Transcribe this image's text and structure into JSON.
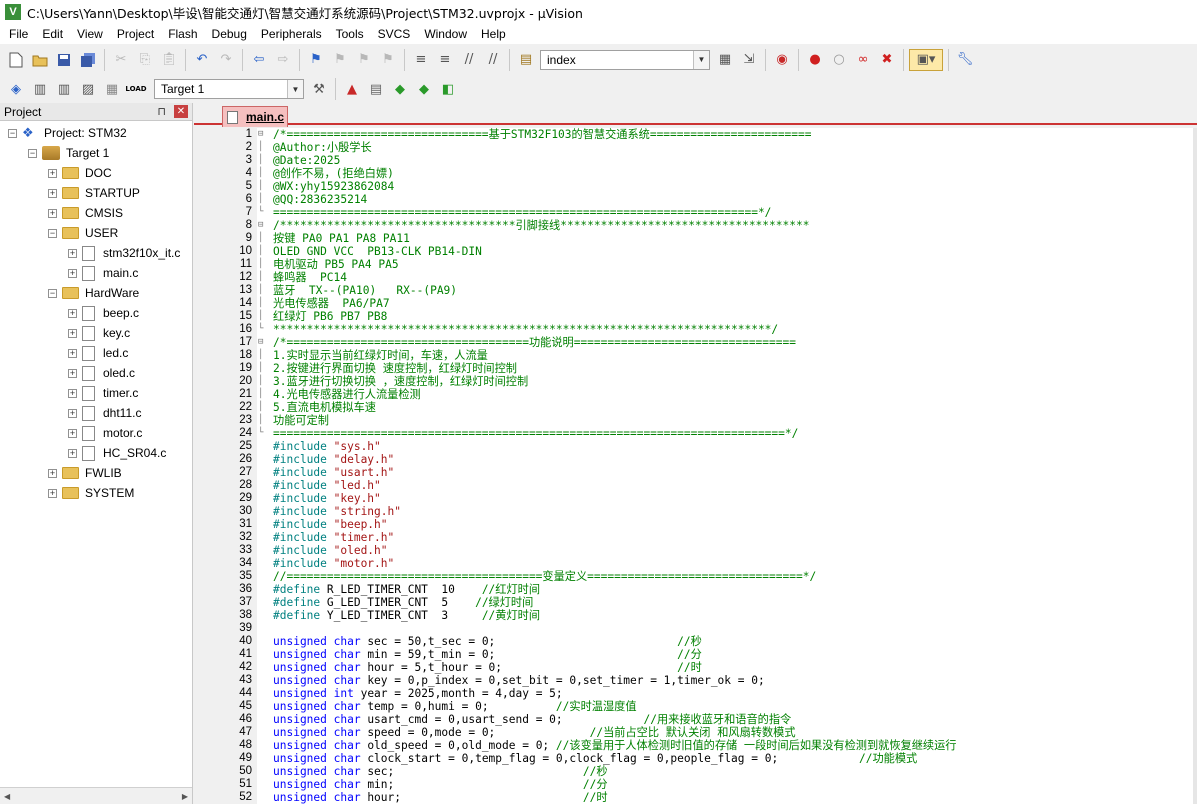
{
  "window": {
    "title": "C:\\Users\\Yann\\Desktop\\毕设\\智能交通灯\\智慧交通灯系统源码\\Project\\STM32.uvprojx - µVision",
    "app_icon": "V"
  },
  "menu": [
    "File",
    "Edit",
    "View",
    "Project",
    "Flash",
    "Debug",
    "Peripherals",
    "Tools",
    "SVCS",
    "Window",
    "Help"
  ],
  "toolbar1": {
    "find_value": "index"
  },
  "toolbar2": {
    "target_value": "Target 1",
    "load_label": "LOAD"
  },
  "project_panel": {
    "title": "Project",
    "pin_glyph": "⊓",
    "close_glyph": "✕",
    "project_label": "Project: STM32",
    "target_label": "Target 1",
    "groups": {
      "doc": "DOC",
      "startup": "STARTUP",
      "cmsis": "CMSIS",
      "user": "USER",
      "user_files": [
        "stm32f10x_it.c",
        "main.c"
      ],
      "hardware": "HardWare",
      "hardware_files": [
        "beep.c",
        "key.c",
        "led.c",
        "oled.c",
        "timer.c",
        "dht11.c",
        "motor.c",
        "HC_SR04.c"
      ],
      "fwlib": "FWLIB",
      "system": "SYSTEM"
    }
  },
  "editor": {
    "tab_label": "main.c",
    "lines": [
      {
        "n": "1",
        "fold": "⊟",
        "segs": [
          {
            "t": "/*==============================基于STM32F103的智慧交通系统========================",
            "c": "c"
          }
        ]
      },
      {
        "n": "2",
        "fold": "│",
        "segs": [
          {
            "t": "@Author:小殷学长",
            "c": "c"
          }
        ]
      },
      {
        "n": "3",
        "fold": "│",
        "segs": [
          {
            "t": "@Date:2025",
            "c": "c"
          }
        ]
      },
      {
        "n": "4",
        "fold": "│",
        "segs": [
          {
            "t": "@创作不易，(拒绝白嫖)",
            "c": "c"
          }
        ]
      },
      {
        "n": "5",
        "fold": "│",
        "segs": [
          {
            "t": "@WX:yhy15923862084",
            "c": "c"
          }
        ]
      },
      {
        "n": "6",
        "fold": "│",
        "segs": [
          {
            "t": "@QQ:2836235214",
            "c": "c"
          }
        ]
      },
      {
        "n": "7",
        "fold": "└",
        "segs": [
          {
            "t": "========================================================================*/",
            "c": "c"
          }
        ]
      },
      {
        "n": "8",
        "fold": "⊟",
        "segs": [
          {
            "t": "/***********************************引脚接线*************************************",
            "c": "c"
          }
        ]
      },
      {
        "n": "9",
        "fold": "│",
        "segs": [
          {
            "t": "按键 PA0 PA1 PA8 PA11",
            "c": "c"
          }
        ]
      },
      {
        "n": "10",
        "fold": "│",
        "segs": [
          {
            "t": "OLED GND VCC  PB13-CLK PB14-DIN",
            "c": "c"
          }
        ]
      },
      {
        "n": "11",
        "fold": "│",
        "segs": [
          {
            "t": "电机驱动 PB5 PA4 PA5",
            "c": "c"
          }
        ]
      },
      {
        "n": "12",
        "fold": "│",
        "segs": [
          {
            "t": "蜂鸣器  PC14",
            "c": "c"
          }
        ]
      },
      {
        "n": "13",
        "fold": "│",
        "segs": [
          {
            "t": "蓝牙  TX--(PA10)   RX--(PA9)",
            "c": "c"
          }
        ]
      },
      {
        "n": "14",
        "fold": "│",
        "segs": [
          {
            "t": "光电传感器  PA6/PA7",
            "c": "c"
          }
        ]
      },
      {
        "n": "15",
        "fold": "│",
        "segs": [
          {
            "t": "红绿灯 PB6 PB7 PB8",
            "c": "c"
          }
        ]
      },
      {
        "n": "16",
        "fold": "└",
        "segs": [
          {
            "t": "**************************************************************************/",
            "c": "c"
          }
        ]
      },
      {
        "n": "17",
        "fold": "⊟",
        "segs": [
          {
            "t": "/*====================================功能说明=================================",
            "c": "c"
          }
        ]
      },
      {
        "n": "18",
        "fold": "│",
        "segs": [
          {
            "t": "1.实时显示当前红绿灯时间，车速，人流量",
            "c": "c"
          }
        ]
      },
      {
        "n": "19",
        "fold": "│",
        "segs": [
          {
            "t": "2.按键进行界面切换 速度控制，红绿灯时间控制",
            "c": "c"
          }
        ]
      },
      {
        "n": "20",
        "fold": "│",
        "segs": [
          {
            "t": "3.蓝牙进行切换切换 ，速度控制，红绿灯时间控制",
            "c": "c"
          }
        ]
      },
      {
        "n": "21",
        "fold": "│",
        "segs": [
          {
            "t": "4.光电传感器进行人流量检测",
            "c": "c"
          }
        ]
      },
      {
        "n": "22",
        "fold": "│",
        "segs": [
          {
            "t": "5.直流电机模拟车速",
            "c": "c"
          }
        ]
      },
      {
        "n": "23",
        "fold": "│",
        "segs": [
          {
            "t": "功能可定制",
            "c": "c"
          }
        ]
      },
      {
        "n": "24",
        "fold": "└",
        "segs": [
          {
            "t": "============================================================================*/",
            "c": "c"
          }
        ]
      },
      {
        "n": "25",
        "fold": "",
        "segs": [
          {
            "t": "#include ",
            "c": "p"
          },
          {
            "t": "\"sys.h\"",
            "c": "s"
          }
        ]
      },
      {
        "n": "26",
        "fold": "",
        "segs": [
          {
            "t": "#include ",
            "c": "p"
          },
          {
            "t": "\"delay.h\"",
            "c": "s"
          }
        ]
      },
      {
        "n": "27",
        "fold": "",
        "segs": [
          {
            "t": "#include ",
            "c": "p"
          },
          {
            "t": "\"usart.h\"",
            "c": "s"
          }
        ]
      },
      {
        "n": "28",
        "fold": "",
        "segs": [
          {
            "t": "#include ",
            "c": "p"
          },
          {
            "t": "\"led.h\"",
            "c": "s"
          }
        ]
      },
      {
        "n": "29",
        "fold": "",
        "segs": [
          {
            "t": "#include ",
            "c": "p"
          },
          {
            "t": "\"key.h\"",
            "c": "s"
          }
        ]
      },
      {
        "n": "30",
        "fold": "",
        "segs": [
          {
            "t": "#include ",
            "c": "p"
          },
          {
            "t": "\"string.h\"",
            "c": "s"
          }
        ]
      },
      {
        "n": "31",
        "fold": "",
        "segs": [
          {
            "t": "#include ",
            "c": "p"
          },
          {
            "t": "\"beep.h\"",
            "c": "s"
          }
        ]
      },
      {
        "n": "32",
        "fold": "",
        "segs": [
          {
            "t": "#include ",
            "c": "p"
          },
          {
            "t": "\"timer.h\"",
            "c": "s"
          }
        ]
      },
      {
        "n": "33",
        "fold": "",
        "segs": [
          {
            "t": "#include ",
            "c": "p"
          },
          {
            "t": "\"oled.h\"",
            "c": "s"
          }
        ]
      },
      {
        "n": "34",
        "fold": "",
        "segs": [
          {
            "t": "#include ",
            "c": "p"
          },
          {
            "t": "\"motor.h\"",
            "c": "s"
          }
        ]
      },
      {
        "n": "35",
        "fold": "",
        "segs": [
          {
            "t": "//======================================变量定义================================*/",
            "c": "c"
          }
        ]
      },
      {
        "n": "36",
        "fold": "",
        "segs": [
          {
            "t": "#define ",
            "c": "p"
          },
          {
            "t": "R_LED_TIMER_CNT  10    ",
            "c": "n"
          },
          {
            "t": "//红灯时间",
            "c": "c"
          }
        ]
      },
      {
        "n": "37",
        "fold": "",
        "segs": [
          {
            "t": "#define ",
            "c": "p"
          },
          {
            "t": "G_LED_TIMER_CNT  5    ",
            "c": "n"
          },
          {
            "t": "//绿灯时间",
            "c": "c"
          }
        ]
      },
      {
        "n": "38",
        "fold": "",
        "segs": [
          {
            "t": "#define ",
            "c": "p"
          },
          {
            "t": "Y_LED_TIMER_CNT  3     ",
            "c": "n"
          },
          {
            "t": "//黄灯时间",
            "c": "c"
          }
        ]
      },
      {
        "n": "39",
        "fold": "",
        "segs": []
      },
      {
        "n": "40",
        "fold": "",
        "segs": [
          {
            "t": "unsigned ",
            "c": "k"
          },
          {
            "t": "char ",
            "c": "k"
          },
          {
            "t": "sec = 50,t_sec = 0;                           ",
            "c": "n"
          },
          {
            "t": "//秒",
            "c": "c"
          }
        ]
      },
      {
        "n": "41",
        "fold": "",
        "segs": [
          {
            "t": "unsigned ",
            "c": "k"
          },
          {
            "t": "char ",
            "c": "k"
          },
          {
            "t": "min = 59,t_min = 0;                           ",
            "c": "n"
          },
          {
            "t": "//分",
            "c": "c"
          }
        ]
      },
      {
        "n": "42",
        "fold": "",
        "segs": [
          {
            "t": "unsigned ",
            "c": "k"
          },
          {
            "t": "char ",
            "c": "k"
          },
          {
            "t": "hour = 5,t_hour = 0;                          ",
            "c": "n"
          },
          {
            "t": "//时",
            "c": "c"
          }
        ]
      },
      {
        "n": "43",
        "fold": "",
        "segs": [
          {
            "t": "unsigned ",
            "c": "k"
          },
          {
            "t": "char ",
            "c": "k"
          },
          {
            "t": "key = 0,p_index = 0,set_bit = 0,set_timer = 1,timer_ok = 0;",
            "c": "n"
          }
        ]
      },
      {
        "n": "44",
        "fold": "",
        "segs": [
          {
            "t": "unsigned ",
            "c": "k"
          },
          {
            "t": "int ",
            "c": "k"
          },
          {
            "t": "year = 2025,month = 4,day = 5;",
            "c": "n"
          }
        ]
      },
      {
        "n": "45",
        "fold": "",
        "segs": [
          {
            "t": "unsigned ",
            "c": "k"
          },
          {
            "t": "char ",
            "c": "k"
          },
          {
            "t": "temp = 0,humi = 0;          ",
            "c": "n"
          },
          {
            "t": "//实时温湿度值",
            "c": "c"
          }
        ]
      },
      {
        "n": "46",
        "fold": "",
        "segs": [
          {
            "t": "unsigned ",
            "c": "k"
          },
          {
            "t": "char ",
            "c": "k"
          },
          {
            "t": "usart_cmd = 0,usart_send = 0;            ",
            "c": "n"
          },
          {
            "t": "//用来接收蓝牙和语音的指令",
            "c": "c"
          }
        ]
      },
      {
        "n": "47",
        "fold": "",
        "segs": [
          {
            "t": "unsigned ",
            "c": "k"
          },
          {
            "t": "char ",
            "c": "k"
          },
          {
            "t": "speed = 0,mode = 0;              ",
            "c": "n"
          },
          {
            "t": "//当前占空比 默认关闭 和风扇转数模式",
            "c": "c"
          }
        ]
      },
      {
        "n": "48",
        "fold": "",
        "segs": [
          {
            "t": "unsigned ",
            "c": "k"
          },
          {
            "t": "char ",
            "c": "k"
          },
          {
            "t": "old_speed = 0,old_mode = 0; ",
            "c": "n"
          },
          {
            "t": "//该变量用于人体检测时旧值的存储 一段时间后如果没有检测到就恢复继续运行",
            "c": "c"
          }
        ]
      },
      {
        "n": "49",
        "fold": "",
        "segs": [
          {
            "t": "unsigned ",
            "c": "k"
          },
          {
            "t": "char ",
            "c": "k"
          },
          {
            "t": "clock_start = 0,temp_flag = 0,clock_flag = 0,people_flag = 0;            ",
            "c": "n"
          },
          {
            "t": "//功能模式",
            "c": "c"
          }
        ]
      },
      {
        "n": "50",
        "fold": "",
        "segs": [
          {
            "t": "unsigned ",
            "c": "k"
          },
          {
            "t": "char ",
            "c": "k"
          },
          {
            "t": "sec;                            ",
            "c": "n"
          },
          {
            "t": "//秒",
            "c": "c"
          }
        ]
      },
      {
        "n": "51",
        "fold": "",
        "segs": [
          {
            "t": "unsigned ",
            "c": "k"
          },
          {
            "t": "char ",
            "c": "k"
          },
          {
            "t": "min;                            ",
            "c": "n"
          },
          {
            "t": "//分",
            "c": "c"
          }
        ]
      },
      {
        "n": "52",
        "fold": "",
        "segs": [
          {
            "t": "unsigned ",
            "c": "k"
          },
          {
            "t": "char ",
            "c": "k"
          },
          {
            "t": "hour;                           ",
            "c": "n"
          },
          {
            "t": "//时",
            "c": "c"
          }
        ]
      }
    ]
  }
}
